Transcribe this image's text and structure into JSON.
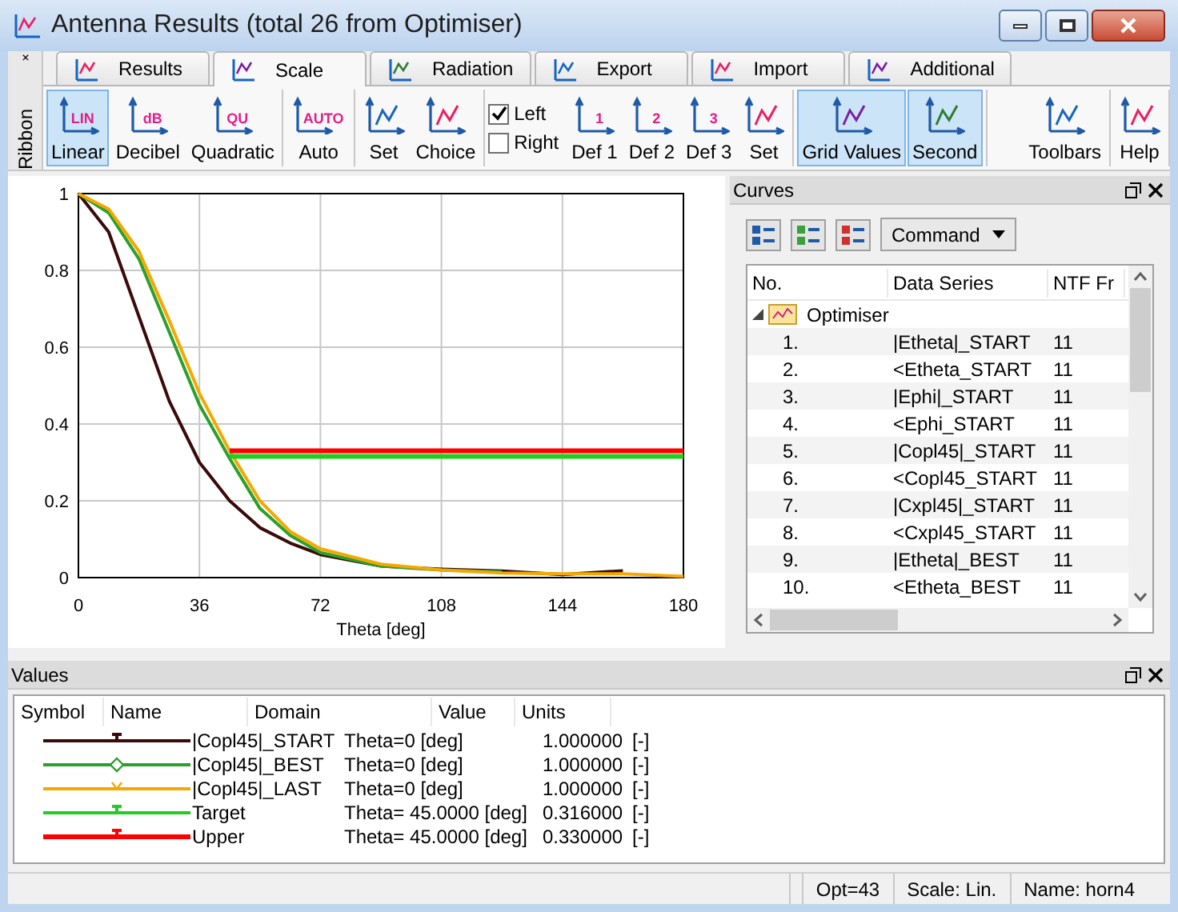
{
  "window": {
    "title": "Antenna Results (total 26 from Optimiser)"
  },
  "ribbon": {
    "label": "Ribbon",
    "tabs": [
      {
        "label": "Results",
        "selected": false
      },
      {
        "label": "Scale",
        "selected": true
      },
      {
        "label": "Radiation",
        "selected": false
      },
      {
        "label": "Export",
        "selected": false
      },
      {
        "label": "Import",
        "selected": false
      },
      {
        "label": "Additional",
        "selected": false
      }
    ],
    "groups": [
      {
        "items": [
          {
            "kind": "button",
            "label": "Linear",
            "icon_text": "LIN",
            "selected": true
          },
          {
            "kind": "button",
            "label": "Decibel",
            "icon_text": "dB",
            "selected": false
          },
          {
            "kind": "button",
            "label": "Quadratic",
            "icon_text": "QU",
            "selected": false
          }
        ]
      },
      {
        "items": [
          {
            "kind": "button",
            "label": "Auto",
            "icon_text": "AUTO",
            "selected": false
          }
        ]
      },
      {
        "items": [
          {
            "kind": "button",
            "label": "Set",
            "selected": false
          },
          {
            "kind": "button",
            "label": "Choice",
            "selected": false
          }
        ]
      },
      {
        "items": [
          {
            "kind": "checks",
            "checks": [
              {
                "label": "Left",
                "checked": true
              },
              {
                "label": "Right",
                "checked": false
              }
            ]
          },
          {
            "kind": "button",
            "label": "Def 1",
            "icon_text": "1",
            "selected": false
          },
          {
            "kind": "button",
            "label": "Def 2",
            "icon_text": "2",
            "selected": false
          },
          {
            "kind": "button",
            "label": "Def 3",
            "icon_text": "3",
            "selected": false
          },
          {
            "kind": "button",
            "label": "Set",
            "selected": false
          }
        ]
      },
      {
        "items": [
          {
            "kind": "button",
            "label": "Grid Values",
            "selected": true
          },
          {
            "kind": "button",
            "label": "Second",
            "selected": true
          }
        ]
      }
    ],
    "right_groups": [
      {
        "items": [
          {
            "kind": "button",
            "label": "Toolbars",
            "selected": false
          }
        ]
      },
      {
        "items": [
          {
            "kind": "button",
            "label": "Help",
            "selected": false
          }
        ]
      }
    ]
  },
  "chart": {
    "chart_data": {
      "type": "line",
      "grid": true,
      "xlabel": "Theta [deg]",
      "x": [
        0,
        9,
        18,
        27,
        36,
        45,
        54,
        63,
        72,
        90,
        108,
        126,
        144,
        162,
        180
      ],
      "xlim": [
        0,
        180
      ],
      "ylim": [
        0,
        1
      ],
      "xticks": [
        0,
        36,
        72,
        108,
        144,
        180
      ],
      "yticks": [
        0,
        0.2,
        0.4,
        0.6,
        0.8,
        {
          "value": 1,
          "label": "1"
        }
      ],
      "series": [
        {
          "color": "#3b0a0a",
          "values": [
            1,
            0.9,
            0.68,
            0.46,
            0.3,
            0.2,
            0.13,
            0.09,
            0.06,
            0.03,
            0.022,
            0.017,
            0.008,
            0.018,
            null
          ]
        },
        {
          "color": "#2ca02c",
          "values": [
            1,
            0.95,
            0.83,
            0.64,
            0.45,
            0.31,
            0.18,
            0.11,
            0.065,
            0.03,
            0.02,
            0.015,
            null,
            null,
            null
          ]
        },
        {
          "color": "#f5a800",
          "values": [
            1,
            0.96,
            0.85,
            0.67,
            0.48,
            0.33,
            0.2,
            0.12,
            0.075,
            0.035,
            0.02,
            0.012,
            0.01,
            0.01,
            0.003
          ]
        },
        {
          "color": "#22cc22",
          "values": [
            null,
            null,
            null,
            null,
            null,
            0.316,
            0.316,
            0.316,
            0.316,
            0.316,
            0.316,
            0.316,
            0.316,
            0.316,
            0.316
          ]
        },
        {
          "color": "#ff0000",
          "values": [
            null,
            null,
            null,
            null,
            null,
            0.33,
            0.33,
            0.33,
            0.33,
            0.33,
            0.33,
            0.33,
            0.33,
            0.33,
            0.33
          ]
        }
      ]
    }
  },
  "curves_panel": {
    "title": "Curves",
    "command": "Command",
    "columns": [
      "No.",
      "Data Series",
      "NTF Fr"
    ],
    "groups": [
      {
        "label": "Optimiser",
        "expanded": true,
        "children": [
          {
            "no": "1.",
            "series": "|Etheta|_START",
            "column_3": "11"
          },
          {
            "no": "2.",
            "series": "<Etheta_START",
            "column_3": "11"
          },
          {
            "no": "3.",
            "series": "|Ephi|_START",
            "column_3": "11"
          },
          {
            "no": "4.",
            "series": "<Ephi_START",
            "column_3": "11"
          },
          {
            "no": "5.",
            "series": "|Copl45|_START",
            "column_3": "11"
          },
          {
            "no": "6.",
            "series": "<Copl45_START",
            "column_3": "11"
          },
          {
            "no": "7.",
            "series": "|Cxpl45|_START",
            "column_3": "11"
          },
          {
            "no": "8.",
            "series": "<Cxpl45_START",
            "column_3": "11"
          },
          {
            "no": "9.",
            "series": "|Etheta|_BEST",
            "column_3": "11"
          },
          {
            "no": "10.",
            "series": "<Etheta_BEST",
            "column_3": "11"
          }
        ]
      }
    ]
  },
  "values_panel": {
    "title": "Values",
    "columns": [
      "Symbol",
      "Name",
      "Domain",
      "Value",
      "Units"
    ],
    "rows": [
      {
        "kind": "tee",
        "color": "#3b0a0a",
        "name": "|Copl45|_START",
        "domain": "Theta=0 [deg]",
        "value": "1.000000",
        "units": "[-]"
      },
      {
        "kind": "diamond",
        "color": "#2ca02c",
        "name": "|Copl45|_BEST",
        "domain": "Theta=0 [deg]",
        "value": "1.000000",
        "units": "[-]"
      },
      {
        "kind": "vee",
        "color": "#f5a800",
        "name": "|Copl45|_LAST",
        "domain": "Theta=0 [deg]",
        "value": "1.000000",
        "units": "[-]"
      },
      {
        "kind": "tee",
        "color": "#22cc22",
        "name": "Target",
        "domain": "Theta= 45.0000 [deg]",
        "value": "0.316000",
        "units": "[-]"
      },
      {
        "kind": "tee",
        "color": "#ff0000",
        "name": "Upper",
        "domain": "Theta= 45.0000 [deg]",
        "value": "0.330000",
        "units": "[-]"
      }
    ]
  },
  "status_bar": [
    "Opt=43",
    "Scale: Lin.",
    "Name: horn4"
  ]
}
